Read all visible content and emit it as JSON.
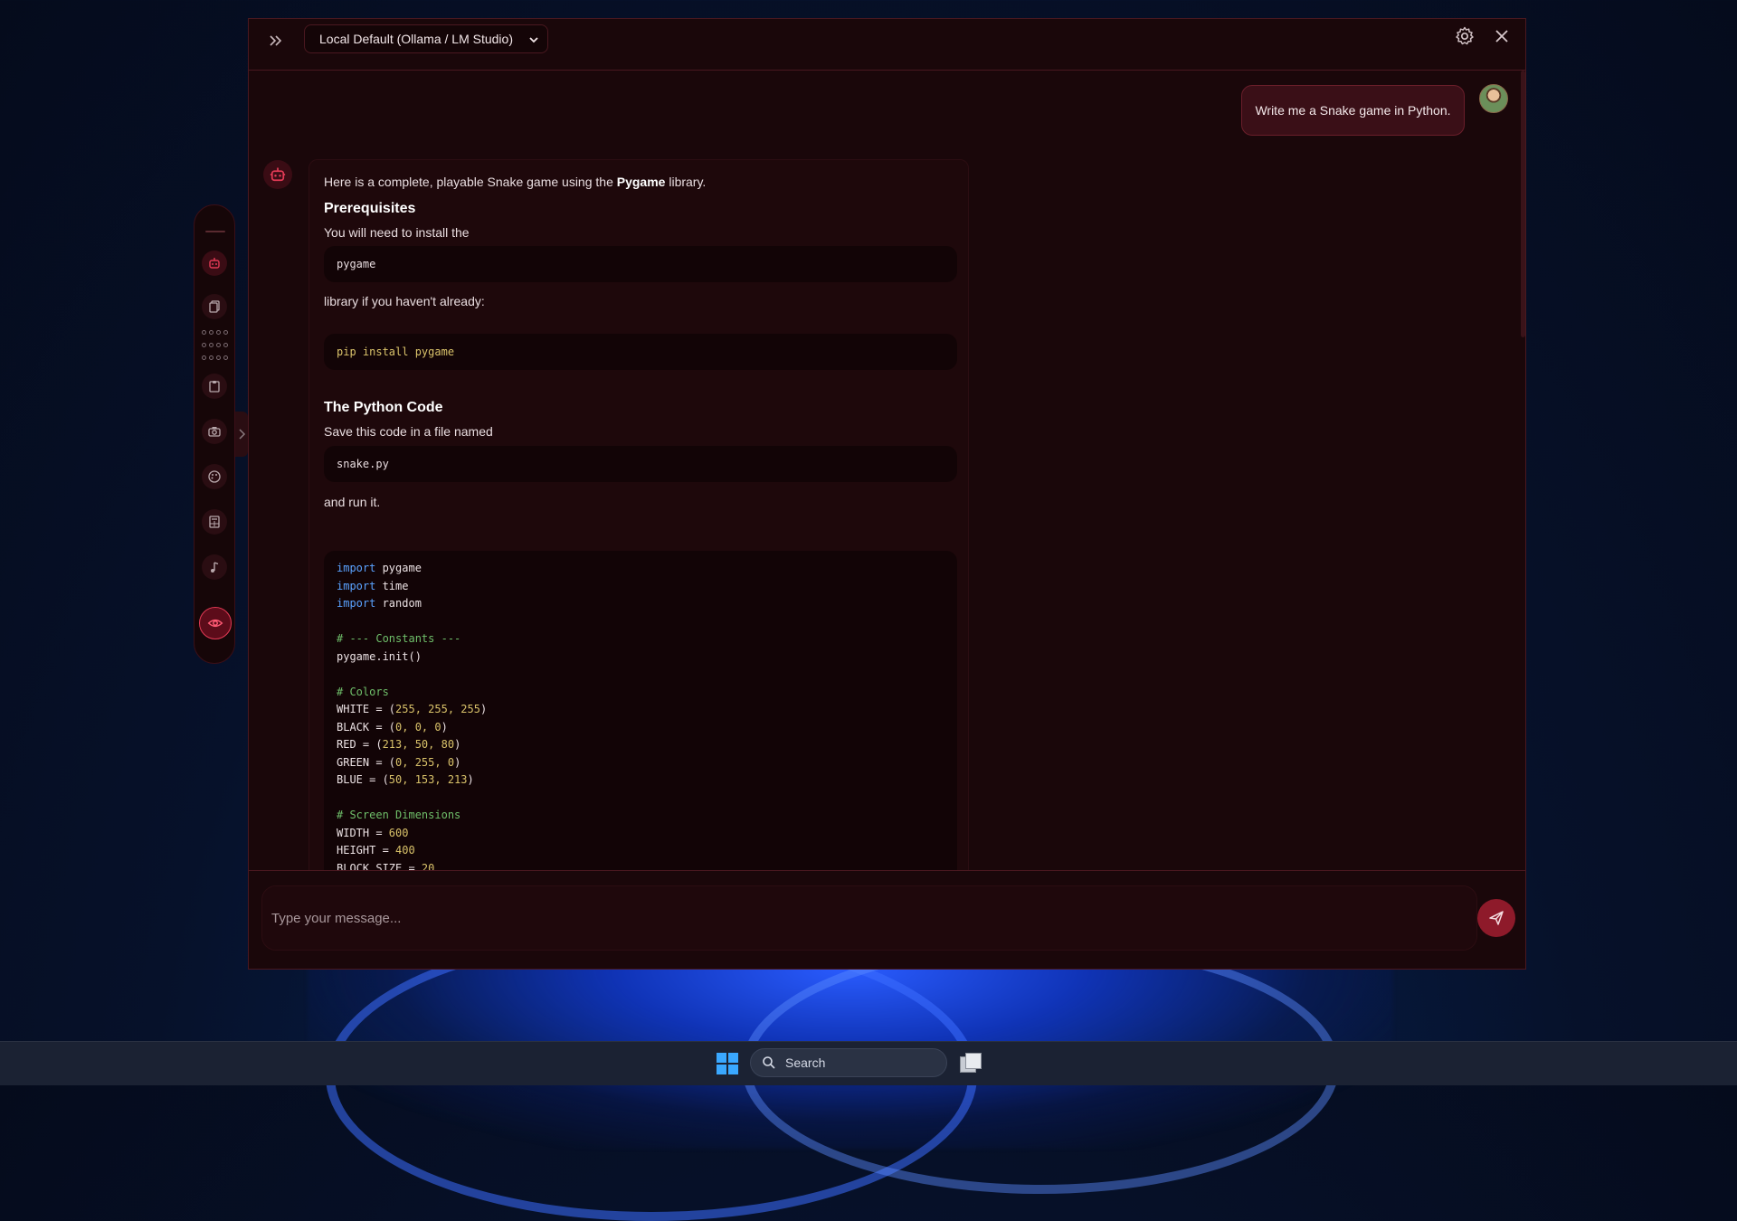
{
  "header": {
    "model_selected": "Local Default (Ollama / LM Studio)"
  },
  "chat": {
    "user_message": "Write me a Snake game in Python.",
    "bot": {
      "intro_before": "Here is a complete, playable Snake game using the ",
      "intro_bold": "Pygame",
      "intro_after": " library.",
      "heading_prereq": "Prerequisites",
      "prereq_text": "You will need to install the",
      "prereq_code": "pygame",
      "prereq_text2": "library if you haven't already:",
      "install_code": "pip install pygame",
      "heading_code": "The Python Code",
      "save_text": "Save this code in a file named",
      "filename_code": "snake.py",
      "run_text": "and run it.",
      "code_lines": [
        {
          "kw": "import",
          "rest": " pygame"
        },
        {
          "kw": "import",
          "rest": " time"
        },
        {
          "kw": "import",
          "rest": " random"
        },
        {
          "plain": ""
        },
        {
          "comment": "# --- Constants ---"
        },
        {
          "plain": "pygame.init()"
        },
        {
          "plain": ""
        },
        {
          "comment": "# Colors"
        },
        {
          "pre": "WHITE = (",
          "nums": "255, 255, 255",
          "post": ")"
        },
        {
          "pre": "BLACK = (",
          "nums": "0, 0, 0",
          "post": ")"
        },
        {
          "pre": "RED = (",
          "nums": "213, 50, 80",
          "post": ")"
        },
        {
          "pre": "GREEN = (",
          "nums": "0, 255, 0",
          "post": ")"
        },
        {
          "pre": "BLUE = (",
          "nums": "50, 153, 213",
          "post": ")"
        },
        {
          "plain": ""
        },
        {
          "comment": "# Screen Dimensions"
        },
        {
          "pre": "WIDTH = ",
          "nums": "600",
          "post": ""
        },
        {
          "pre": "HEIGHT = ",
          "nums": "400",
          "post": ""
        },
        {
          "pre": "BLOCK_SIZE = ",
          "nums": "20",
          "post": ""
        }
      ]
    }
  },
  "input": {
    "placeholder": "Type your message..."
  },
  "taskbar": {
    "search_label": "Search"
  },
  "colors": {
    "accent": "#e23a55",
    "panel": "#1a070a",
    "border": "#4a1820"
  }
}
